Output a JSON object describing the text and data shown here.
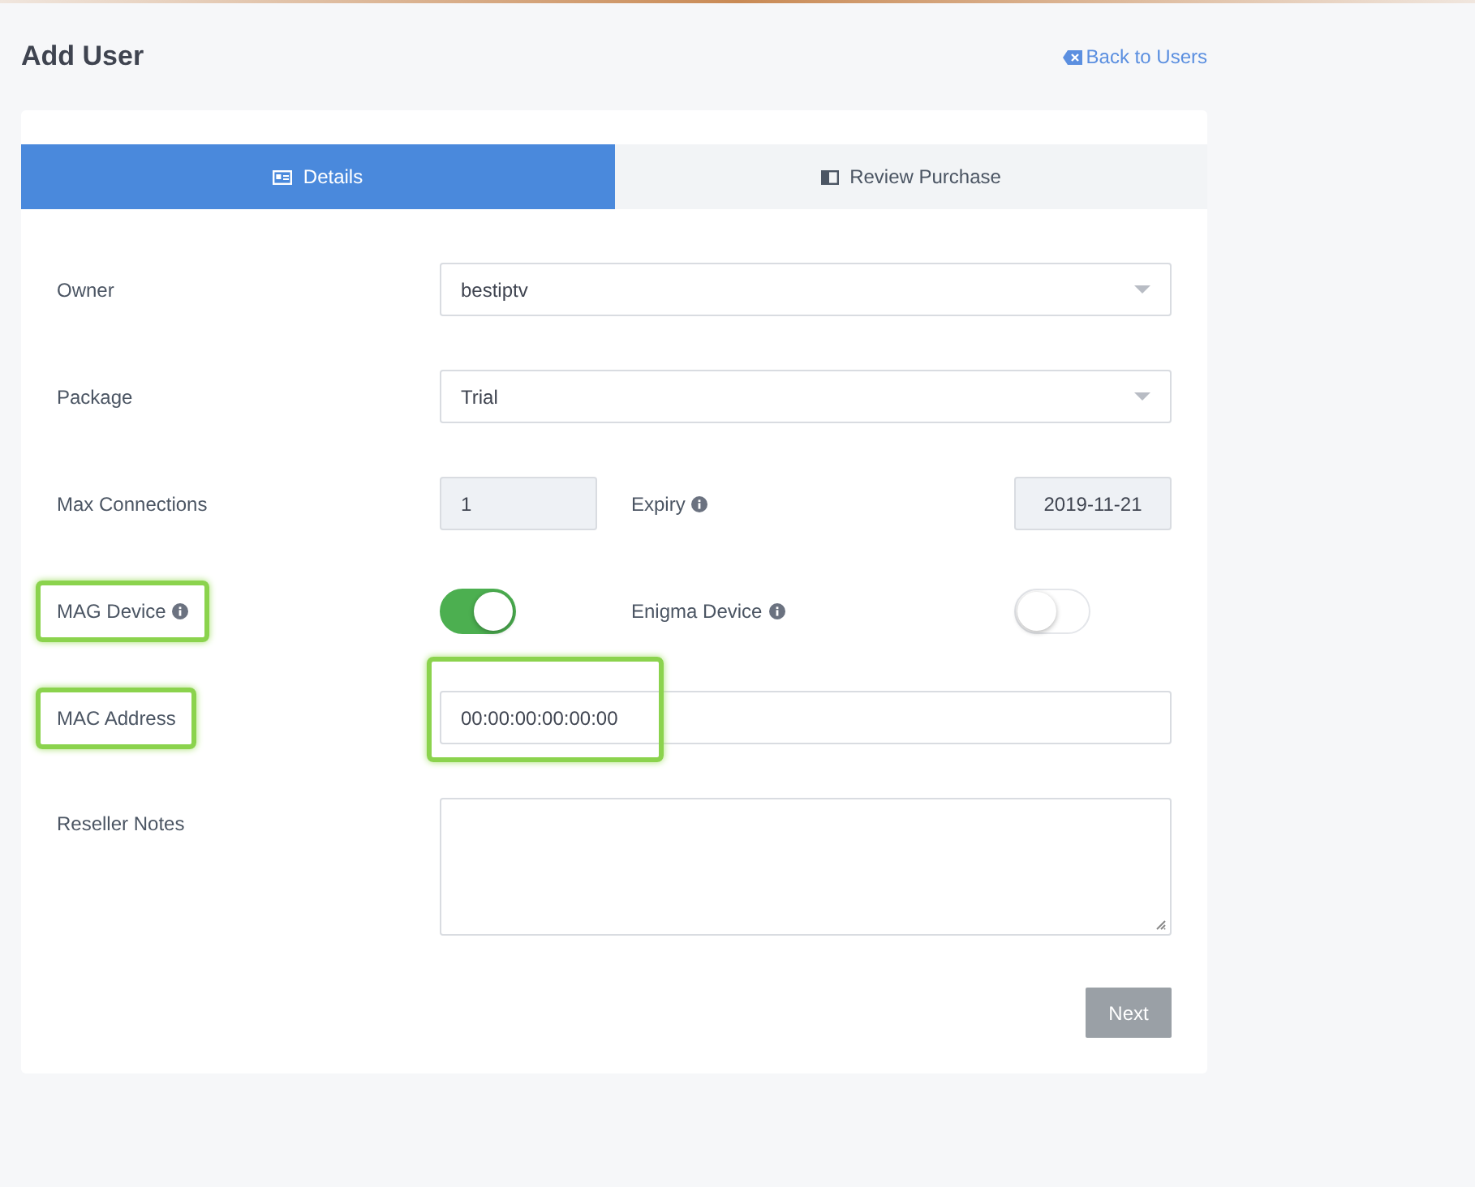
{
  "page": {
    "title": "Add User",
    "back_link": "Back to Users"
  },
  "tabs": [
    {
      "label": "Details",
      "selected": true
    },
    {
      "label": "Review Purchase",
      "selected": false
    }
  ],
  "fields": [
    {
      "kind": "select",
      "label": "Owner",
      "value": "bestiptv"
    },
    {
      "kind": "select",
      "label": "Package",
      "value": "Trial"
    },
    {
      "kind": "pair",
      "label": "Max Connections",
      "value": "1",
      "side_label": "Expiry",
      "side_value": "2019-11-21"
    },
    {
      "kind": "toggles",
      "label": "MAG Device",
      "on": true,
      "side_label": "Enigma Device",
      "side_on": false,
      "highlighted": true
    },
    {
      "kind": "text",
      "label": "MAC Address",
      "value": "00:00:00:00:00:00",
      "highlighted": true,
      "value_highlighted": true
    },
    {
      "kind": "textarea",
      "label": "Reseller Notes"
    }
  ],
  "next_button": "Next"
}
